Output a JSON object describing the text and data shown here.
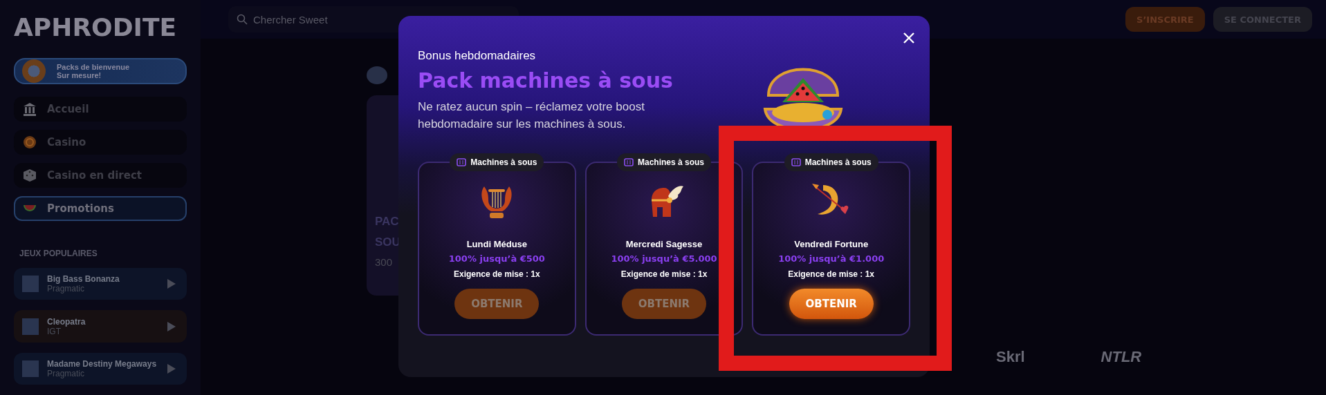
{
  "sidebar": {
    "logo": "APHRODITE",
    "promo_banner": {
      "title": "Packs de bienvenue",
      "subtitle": "Sur mesure!"
    },
    "nav": [
      {
        "label": "Accueil",
        "selected": false
      },
      {
        "label": "Casino",
        "selected": false
      },
      {
        "label": "Casino en direct",
        "selected": false
      },
      {
        "label": "Promotions",
        "selected": true
      }
    ],
    "section_title": "JEUX POPULAIRES",
    "games": [
      {
        "name": "Big Bass Bonanza",
        "provider": "Pragmatic"
      },
      {
        "name": "Cleopatra",
        "provider": "IGT"
      },
      {
        "name": "Madame Destiny Megaways",
        "provider": "Pragmatic"
      }
    ]
  },
  "top_bar": {
    "search": {
      "placeholder": "Chercher Sweet"
    },
    "buttons": [
      "S’INSCRIRE",
      "SE CONNECTER"
    ]
  },
  "background_promo": {
    "lines": [
      "PAC",
      "SOU",
      "300"
    ]
  },
  "footer_logos": [
    "Skrl",
    "NTLR"
  ],
  "modal": {
    "eyebrow": "Bonus hebdomadaires",
    "title": "Pack machines à sous",
    "description": "Ne ratez aucun spin – réclamez votre boost hebdomadaire sur les machines à sous.",
    "cards": [
      {
        "badge": "Machines à sous",
        "name": "Lundi Méduse",
        "offer": "100% jusqu’à €500",
        "wager": "Exigence de mise : 1x",
        "button": "OBTENIR",
        "selected": false
      },
      {
        "badge": "Machines à sous",
        "name": "Mercredi Sagesse",
        "offer": "100% jusqu’à €5.000",
        "wager": "Exigence de mise : 1x",
        "button": "OBTENIR",
        "selected": false
      },
      {
        "badge": "Machines à sous",
        "name": "Vendredi Fortune",
        "offer": "100% jusqu’à €1.000",
        "wager": "Exigence de mise : 1x",
        "button": "OBTENIR",
        "selected": true
      }
    ]
  }
}
